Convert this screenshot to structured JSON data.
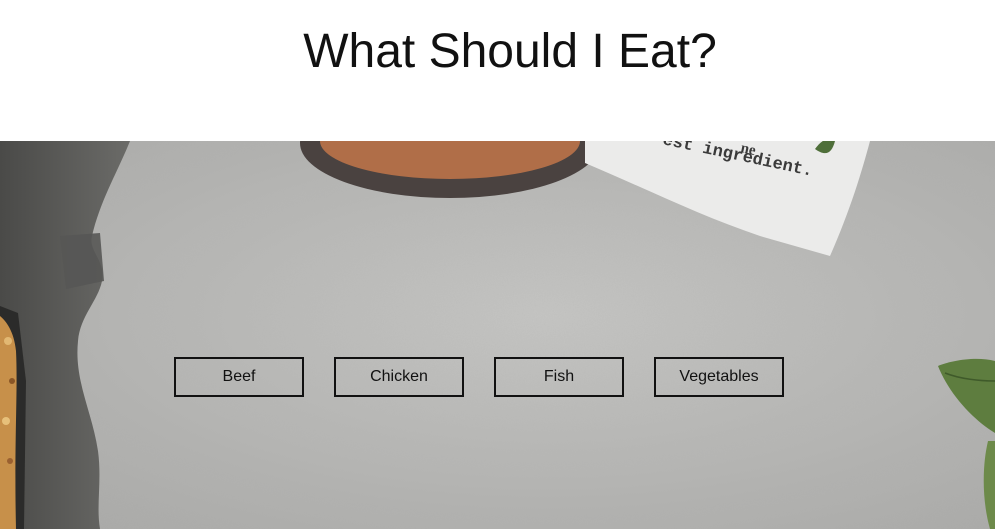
{
  "header": {
    "title": "What Should I Eat?"
  },
  "hero": {
    "towel_text": "est ingredient.",
    "towel_text_partial": "ne",
    "background_color": "#bdbdbb"
  },
  "categories": {
    "items": [
      {
        "label": "Beef"
      },
      {
        "label": "Chicken"
      },
      {
        "label": "Fish"
      },
      {
        "label": "Vegetables"
      }
    ]
  },
  "colors": {
    "border": "#111111",
    "text": "#111111"
  }
}
